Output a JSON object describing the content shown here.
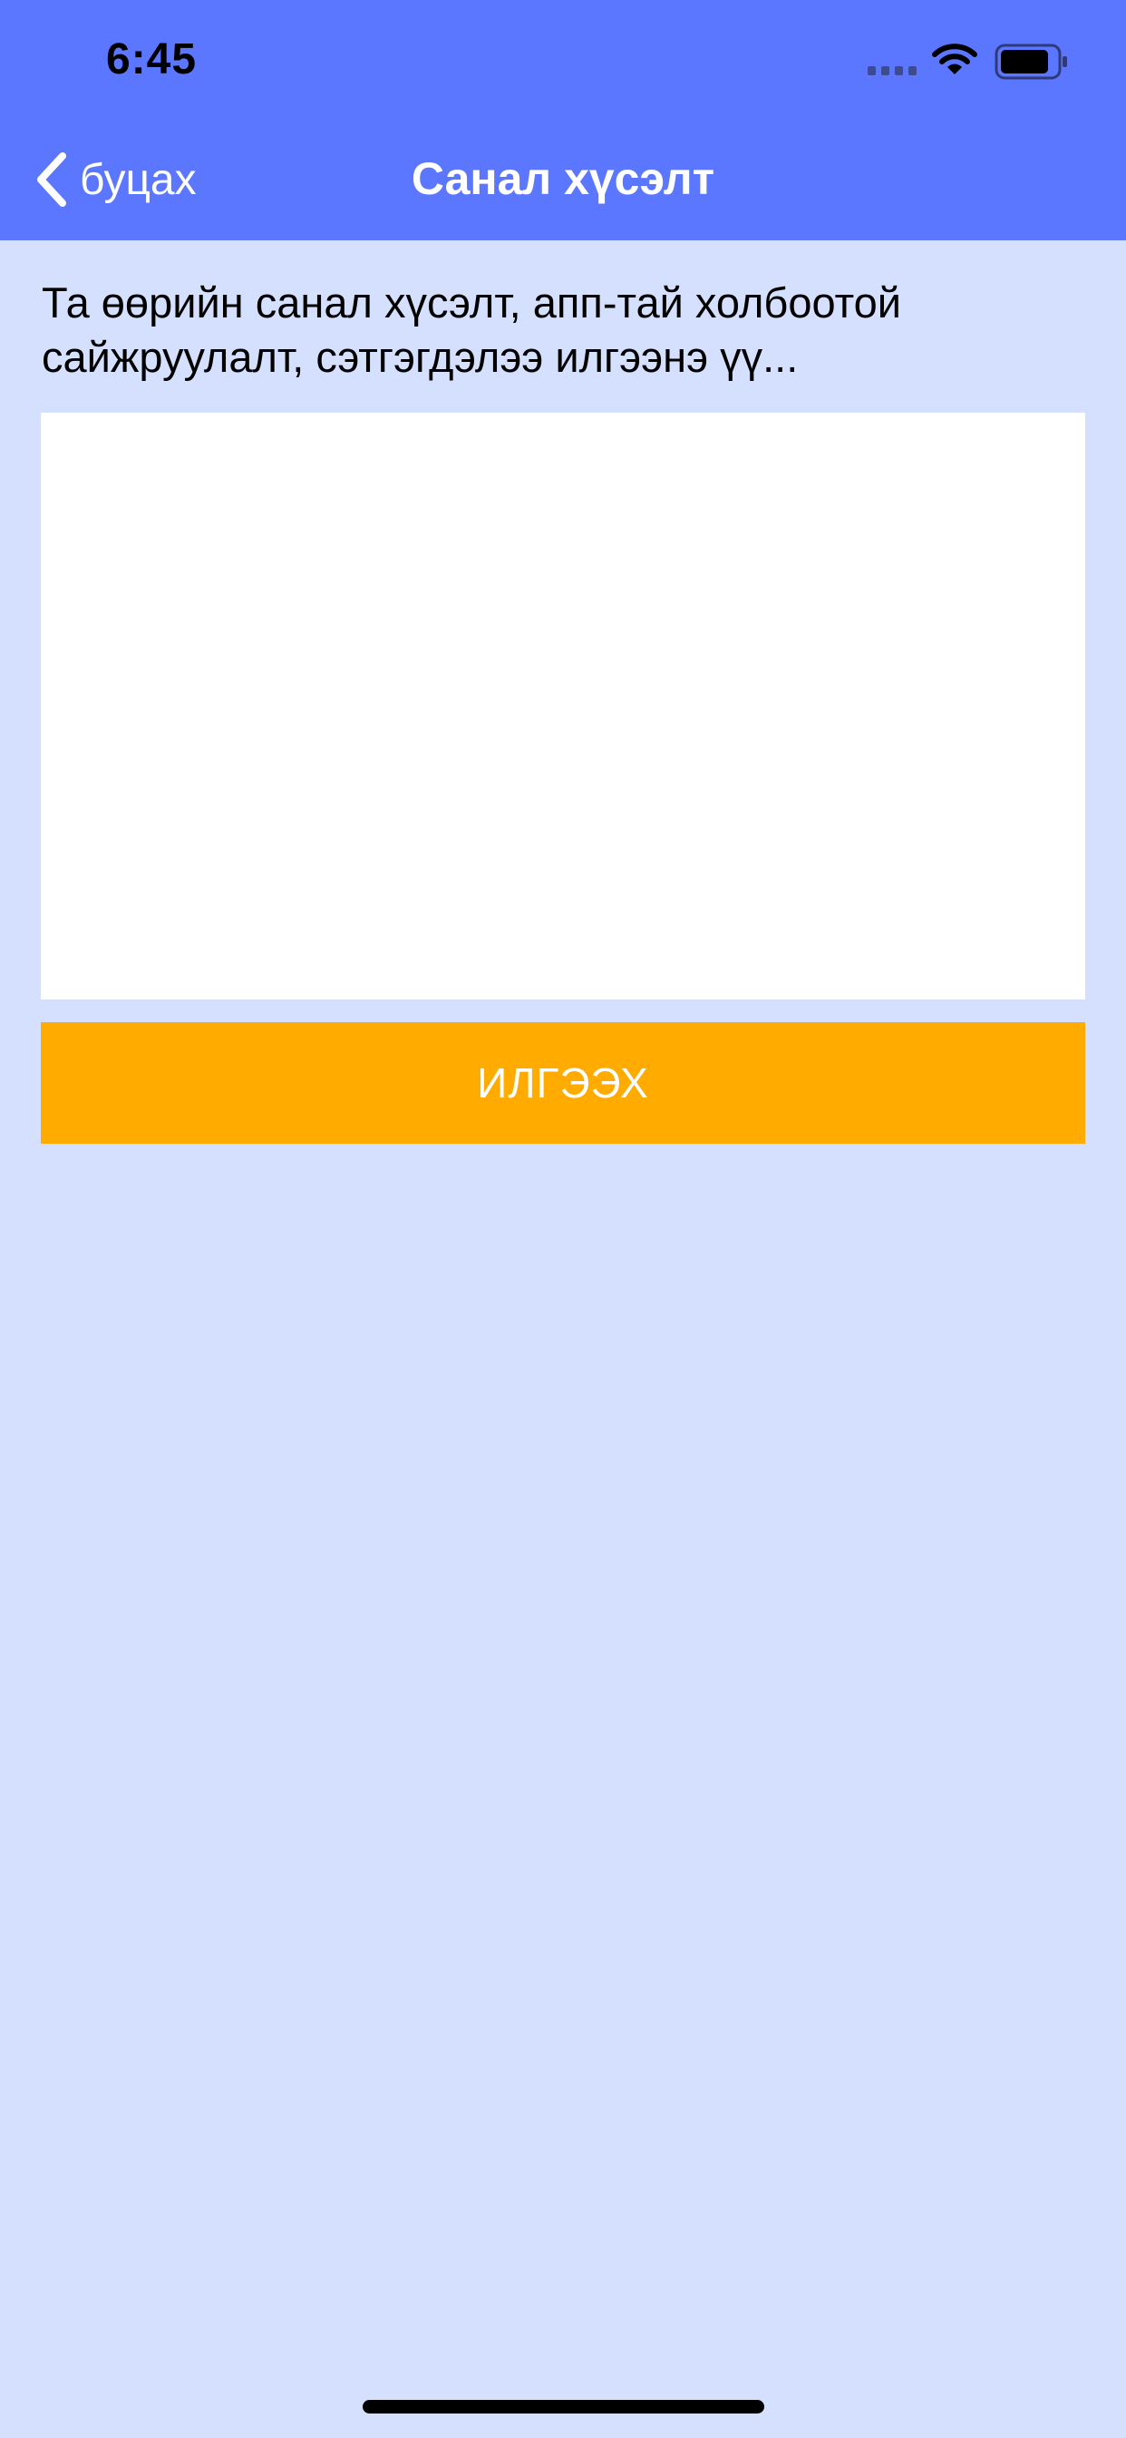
{
  "status_bar": {
    "time": "6:45"
  },
  "nav": {
    "back_label": "буцах",
    "title": "Санал хүсэлт"
  },
  "form": {
    "instruction": "Та өөрийн санал хүсэлт, апп-тай холбоотой сайжруулалт, сэтгэгдэлээ илгээнэ үү...",
    "input_value": "",
    "submit_label": "ИЛГЭЭХ"
  },
  "colors": {
    "header": "#5b77ff",
    "background": "#d5e0fe",
    "submit_button": "#ffab00",
    "input_background": "#ffffff"
  },
  "icons": {
    "back": "chevron-left-icon",
    "signal": "cellular-signal-icon",
    "wifi": "wifi-icon",
    "battery": "battery-icon"
  }
}
